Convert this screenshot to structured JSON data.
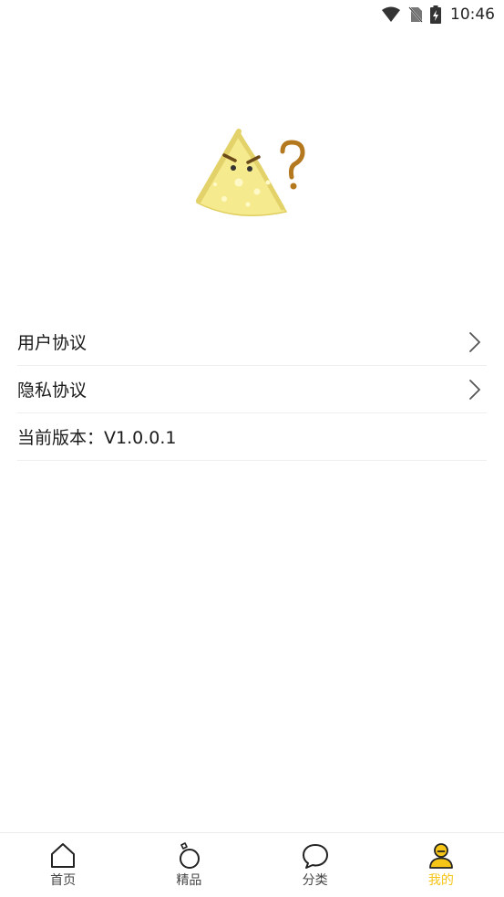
{
  "status_bar": {
    "time": "10:46",
    "icons": [
      "wifi-icon",
      "no-sim-icon",
      "battery-charging-icon"
    ]
  },
  "logo": {
    "icon": "cheese-question-logo"
  },
  "settings": {
    "items": [
      {
        "label": "用户协议",
        "chevron": true
      },
      {
        "label": "隐私协议",
        "chevron": true
      },
      {
        "label": "当前版本：V1.0.0.1",
        "chevron": false
      }
    ]
  },
  "bottom_nav": {
    "items": [
      {
        "label": "首页",
        "icon": "home-icon",
        "active": false
      },
      {
        "label": "精品",
        "icon": "ring-icon",
        "active": false
      },
      {
        "label": "分类",
        "icon": "chat-bubble-icon",
        "active": false
      },
      {
        "label": "我的",
        "icon": "profile-icon",
        "active": true
      }
    ]
  },
  "colors": {
    "accent": "#f5c518",
    "cheese": "#f6ea8e",
    "divider": "#eeeeee"
  }
}
